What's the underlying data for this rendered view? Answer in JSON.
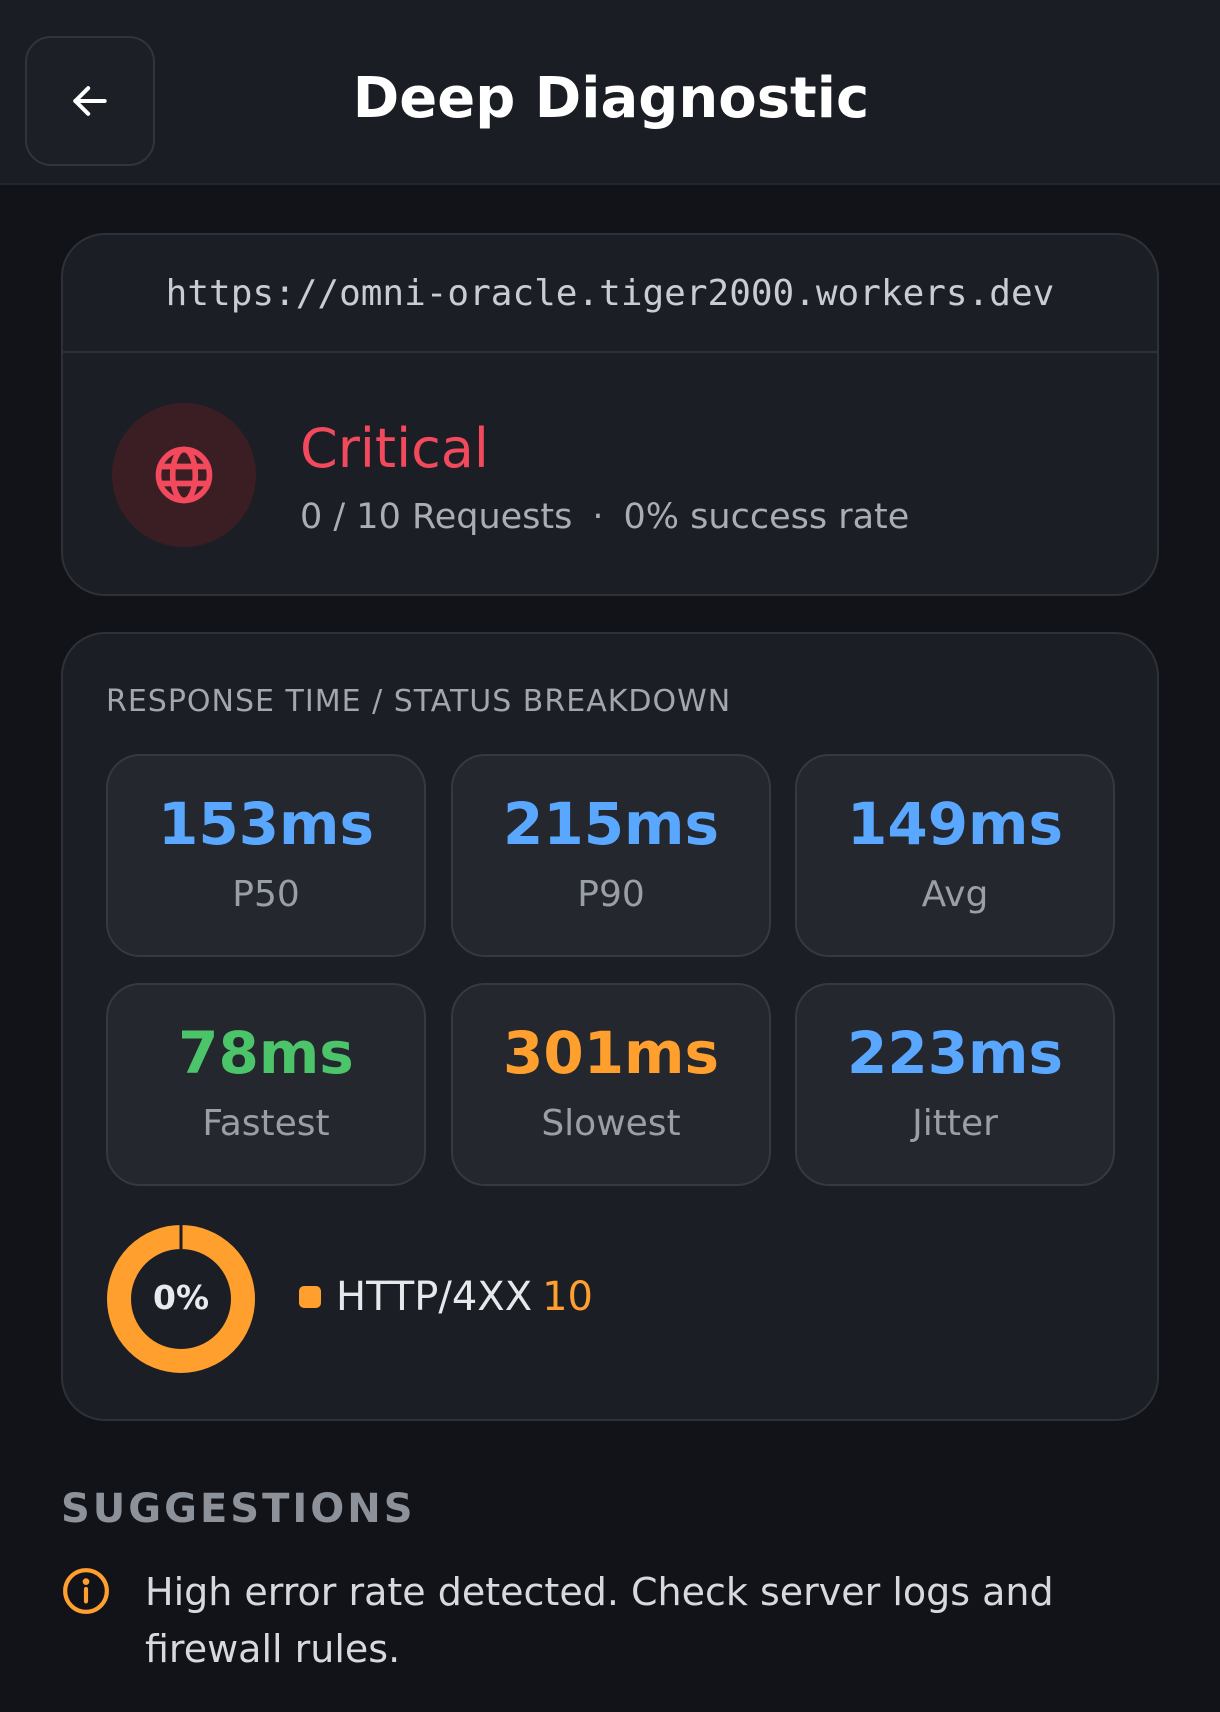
{
  "header": {
    "title": "Deep Diagnostic"
  },
  "target": {
    "url": "https://omni-oracle.tiger2000.workers.dev"
  },
  "status": {
    "level": "Critical",
    "requests": "0 / 10 Requests",
    "separator": "·",
    "success_rate": "0% success rate",
    "icon": "globe-icon",
    "color": "#f2495c"
  },
  "metrics": {
    "section_label": "RESPONSE TIME / STATUS BREAKDOWN",
    "tiles": [
      {
        "value": "153ms",
        "label": "P50",
        "color": "#5aa7ff"
      },
      {
        "value": "215ms",
        "label": "P90",
        "color": "#5aa7ff"
      },
      {
        "value": "149ms",
        "label": "Avg",
        "color": "#5aa7ff"
      },
      {
        "value": "78ms",
        "label": "Fastest",
        "color": "#4cc46a"
      },
      {
        "value": "301ms",
        "label": "Slowest",
        "color": "#ff9f2e"
      },
      {
        "value": "223ms",
        "label": "Jitter",
        "color": "#5aa7ff"
      }
    ]
  },
  "breakdown": {
    "success_percent": "0%",
    "success_fraction": 0,
    "legend": [
      {
        "label": "HTTP/4XX",
        "count": "10",
        "color": "#ff9f2e"
      }
    ]
  },
  "suggestions": {
    "title": "SUGGESTIONS",
    "items": [
      {
        "icon": "info-icon",
        "text": "High error rate detected. Check server logs and firewall rules."
      }
    ]
  }
}
